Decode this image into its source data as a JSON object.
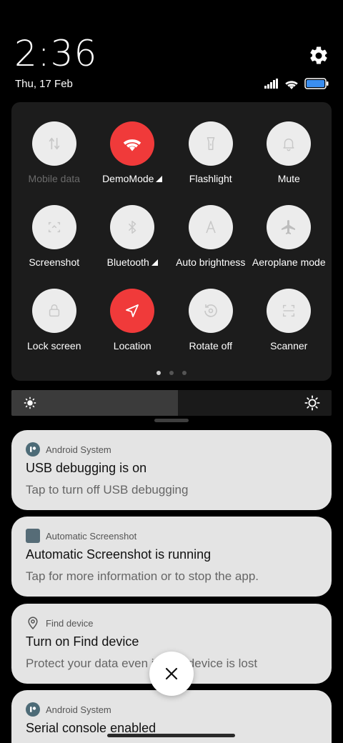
{
  "status": {
    "time": "2:36",
    "date": "Thu, 17 Feb"
  },
  "quick_settings": {
    "tiles": [
      {
        "label": "Mobile data",
        "icon": "mobile-data-icon",
        "active": false,
        "dim": true,
        "expand": false
      },
      {
        "label": "DemoMode",
        "icon": "wifi-icon",
        "active": true,
        "dim": false,
        "expand": true
      },
      {
        "label": "Flashlight",
        "icon": "flashlight-icon",
        "active": false,
        "dim": false,
        "expand": false
      },
      {
        "label": "Mute",
        "icon": "bell-icon",
        "active": false,
        "dim": false,
        "expand": false
      },
      {
        "label": "Screenshot",
        "icon": "screenshot-icon",
        "active": false,
        "dim": false,
        "expand": false
      },
      {
        "label": "Bluetooth",
        "icon": "bluetooth-icon",
        "active": false,
        "dim": false,
        "expand": true
      },
      {
        "label": "Auto brightness",
        "icon": "auto-brightness-icon",
        "active": false,
        "dim": false,
        "expand": false
      },
      {
        "label": "Aeroplane mode",
        "icon": "airplane-icon",
        "active": false,
        "dim": false,
        "expand": false
      },
      {
        "label": "Lock screen",
        "icon": "lock-icon",
        "active": false,
        "dim": false,
        "expand": false
      },
      {
        "label": "Location",
        "icon": "location-icon",
        "active": true,
        "dim": false,
        "expand": false
      },
      {
        "label": "Rotate off",
        "icon": "rotate-icon",
        "active": false,
        "dim": false,
        "expand": false
      },
      {
        "label": "Scanner",
        "icon": "scanner-icon",
        "active": false,
        "dim": false,
        "expand": false
      }
    ],
    "page_count": 3,
    "current_page": 1
  },
  "brightness": {
    "level": 0.52
  },
  "notifications": [
    {
      "app": "Android System",
      "app_icon": "android-system-icon",
      "title": "USB debugging is on",
      "body": "Tap to turn off USB debugging"
    },
    {
      "app": "Automatic Screenshot",
      "app_icon": "screenshot-app-icon",
      "title": "Automatic Screenshot is running",
      "body": "Tap for more information or to stop the app."
    },
    {
      "app": "Find device",
      "app_icon": "find-device-icon",
      "title": "Turn on Find device",
      "body": "Protect your data even if your device is lost"
    },
    {
      "app": "Android System",
      "app_icon": "android-system-icon",
      "title": "Serial console enabled",
      "body": ""
    }
  ],
  "colors": {
    "accent_active": "#f03a3a",
    "battery": "#3a8ef0"
  }
}
